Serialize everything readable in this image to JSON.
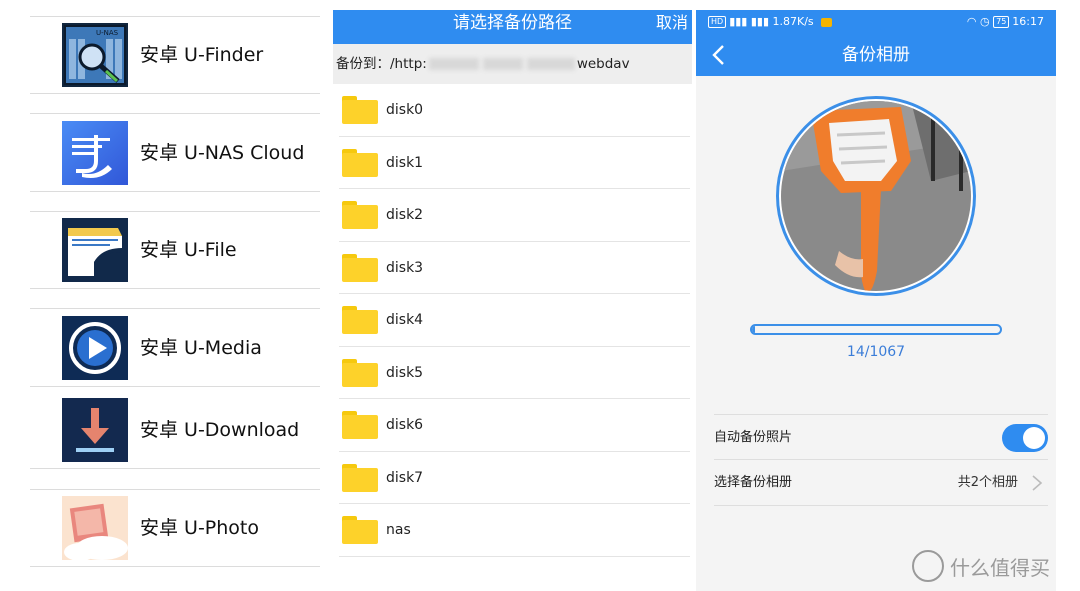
{
  "apps": [
    {
      "label": "安卓 U-Finder",
      "icon": "u-finder-icon",
      "badge": "U-NAS"
    },
    {
      "label": "安卓 U-NAS Cloud",
      "icon": "u-nas-cloud-icon"
    },
    {
      "label": "安卓 U-File",
      "icon": "u-file-icon"
    },
    {
      "label": "安卓 U-Media",
      "icon": "u-media-icon"
    },
    {
      "label": "安卓 U-Download",
      "icon": "u-download-icon"
    },
    {
      "label": "安卓 U-Photo",
      "icon": "u-photo-icon"
    }
  ],
  "picker": {
    "title": "请选择备份路径",
    "cancel": "取消",
    "path_prefix": "备份到：/http:",
    "path_suffix": "webdav",
    "folders": [
      "disk0",
      "disk1",
      "disk2",
      "disk3",
      "disk4",
      "disk5",
      "disk6",
      "disk7",
      "nas"
    ]
  },
  "phone": {
    "status_left_badge": "HD",
    "status_left": "1.87K/s",
    "status_right": "16:17",
    "battery": "75",
    "title": "备份相册",
    "progress": {
      "current": 14,
      "total": 1067,
      "text": "14/1067"
    },
    "settings": {
      "auto_backup_label": "自动备份照片",
      "auto_backup_on": true,
      "choose_album_label": "选择备份相册",
      "choose_album_value": "共2个相册"
    }
  },
  "watermark": {
    "text": "什么值得买",
    "icon": "smzdm-logo-icon"
  },
  "colors": {
    "accent": "#2f8cf0",
    "folder": "#fdd22a"
  }
}
